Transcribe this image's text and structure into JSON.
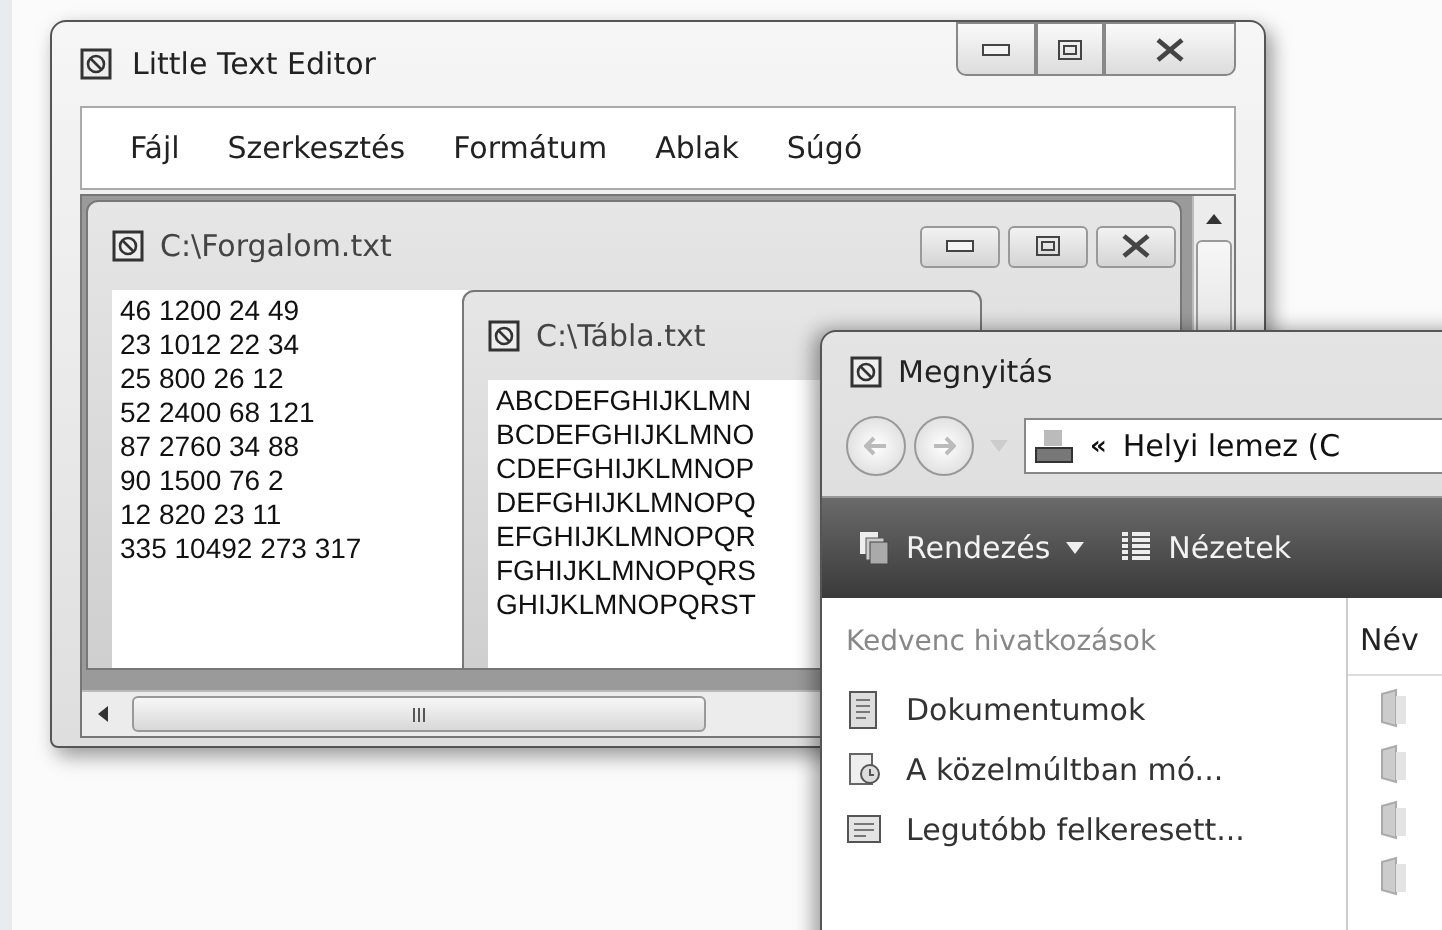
{
  "editor": {
    "title": "Little Text Editor",
    "menu": [
      "Fájl",
      "Szerkesztés",
      "Formátum",
      "Ablak",
      "Súgó"
    ],
    "documents": [
      {
        "title": "C:\\Forgalom.txt",
        "lines": [
          "46 1200 24 49",
          "23 1012 22 34",
          "25 800 26 12",
          "52 2400 68 121",
          "87 2760 34 88",
          "90 1500 76 2",
          "12 820 23 11",
          "335 10492 273 317"
        ]
      },
      {
        "title": "C:\\Tábla.txt",
        "lines": [
          "ABCDEFGHIJKLMN",
          "BCDEFGHIJKLMNO",
          "CDEFGHIJKLMNOP",
          "DEFGHIJKLMNOPQ",
          "EFGHIJKLMNOPQR",
          "FGHIJKLMNOPQRS",
          "GHIJKLMNOPQRST"
        ]
      }
    ]
  },
  "dialog": {
    "title": "Megnyitás",
    "breadcrumb": "«",
    "address": "Helyi lemez (C",
    "toolbar": [
      {
        "label": "Rendezés",
        "kind": "menu"
      },
      {
        "label": "Nézetek",
        "kind": "views"
      }
    ],
    "favorites_heading": "Kedvenc hivatkozások",
    "favorites": [
      {
        "label": "Dokumentumok",
        "kind": "documents"
      },
      {
        "label": "A közelmúltban mó...",
        "kind": "recent"
      },
      {
        "label": "Legutóbb felkeresett...",
        "kind": "places"
      }
    ],
    "column": "Név"
  }
}
